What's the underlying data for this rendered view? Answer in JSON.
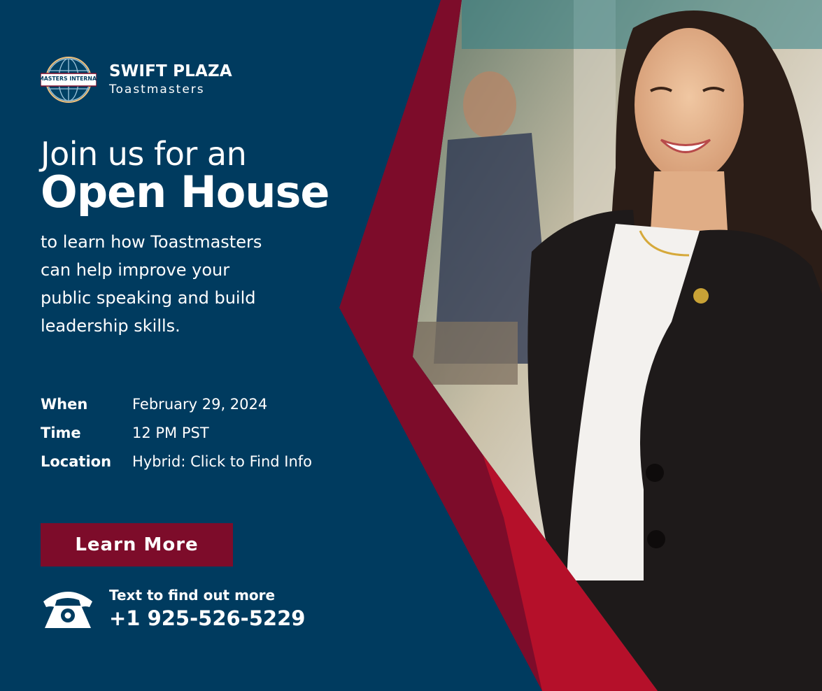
{
  "brand": {
    "logo_text": "TOASTMASTERS INTERNATIONAL",
    "name": "SWIFT PLAZA",
    "subtitle": "Toastmasters"
  },
  "headline": {
    "line1": "Join us for an",
    "line2": "Open House"
  },
  "intro": {
    "lines": [
      "to learn how Toastmasters",
      "can help improve your",
      "public speaking and build",
      "leadership skills."
    ]
  },
  "details": [
    {
      "label": "When",
      "value": "February 29, 2024"
    },
    {
      "label": "Time",
      "value": "12 PM PST"
    },
    {
      "label": "Location",
      "value": "Hybrid: Click to Find Info"
    }
  ],
  "cta": {
    "label": "Learn More"
  },
  "contact": {
    "icon": "telephone-icon",
    "caption": "Text to find out more",
    "phone": "+1 925-526-5229"
  },
  "colors": {
    "navy": "#003b5f",
    "maroon": "#7d0c2a",
    "red": "#b5102a",
    "text": "#ffffff"
  }
}
